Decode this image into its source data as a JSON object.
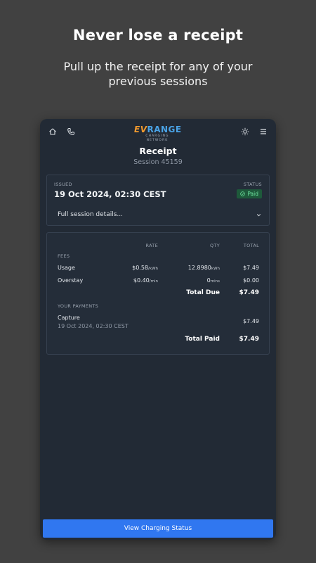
{
  "promo": {
    "headline": "Never lose a receipt",
    "subline": "Pull up the receipt for any of your previous sessions"
  },
  "topbar": {
    "logo_ev": "EV",
    "logo_range": "RANGE",
    "logo_sub": "CHARGING NETWORK",
    "icons": [
      "home-icon",
      "phone-icon",
      "sun-icon",
      "menu-icon"
    ]
  },
  "receipt": {
    "title": "Receipt",
    "session": "Session 45159",
    "issued_label": "ISSUED",
    "issued_date": "19 Oct 2024, 02:30 CEST",
    "status_label": "STATUS",
    "status_value": "Paid",
    "details_label": "Full session details..."
  },
  "fees": {
    "col_rate": "RATE",
    "col_qty": "QTY",
    "col_total": "TOTAL",
    "section_label": "FEES",
    "rows": [
      {
        "name": "Usage",
        "rate": "$0.58",
        "rate_unit": "/kWh",
        "qty": "12.8980",
        "qty_unit": "kWh",
        "total": "$7.49"
      },
      {
        "name": "Overstay",
        "rate": "$0.40",
        "rate_unit": "/min",
        "qty": "0",
        "qty_unit": "mins",
        "total": "$0.00"
      }
    ],
    "total_due_label": "Total Due",
    "total_due": "$7.49"
  },
  "payments": {
    "section_label": "YOUR PAYMENTS",
    "rows": [
      {
        "name": "Capture",
        "date": "19 Oct 2024, 02:30 CEST",
        "amount": "$7.49"
      }
    ],
    "total_paid_label": "Total Paid",
    "total_paid": "$7.49"
  },
  "footer": {
    "button_label": "View Charging Status",
    "accent": "#3077f0"
  },
  "colors": {
    "background": "#414141",
    "panel": "#222a35",
    "paid_badge_bg": "#1e5a3b",
    "paid_badge_fg": "#6fe3a0"
  }
}
